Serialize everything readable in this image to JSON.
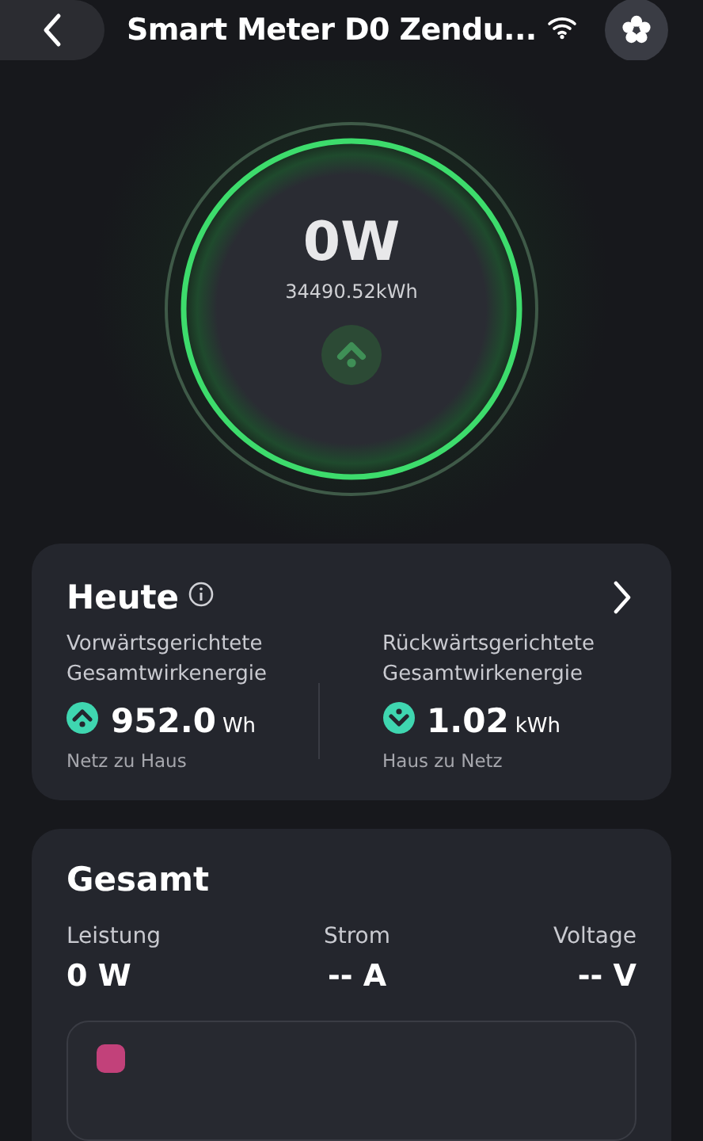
{
  "header": {
    "title": "Smart Meter D0 Zendu..."
  },
  "gauge": {
    "power": "0W",
    "energy": "34490.52kWh"
  },
  "today": {
    "title": "Heute",
    "items": [
      {
        "label": "Vorwärtsgerichtete Gesamtwirkenergie",
        "value": "952.0",
        "unit": "Wh",
        "caption": "Netz zu Haus",
        "kind": "import"
      },
      {
        "label": "Rückwärtsgerichtete Gesamtwirkenergie",
        "value": "1.02",
        "unit": "kWh",
        "caption": "Haus zu Netz",
        "kind": "export"
      }
    ]
  },
  "total": {
    "title": "Gesamt",
    "metrics": [
      {
        "label": "Leistung",
        "value": "0 W"
      },
      {
        "label": "Strom",
        "value": "-- A"
      },
      {
        "label": "Voltage",
        "value": "-- V"
      }
    ]
  }
}
